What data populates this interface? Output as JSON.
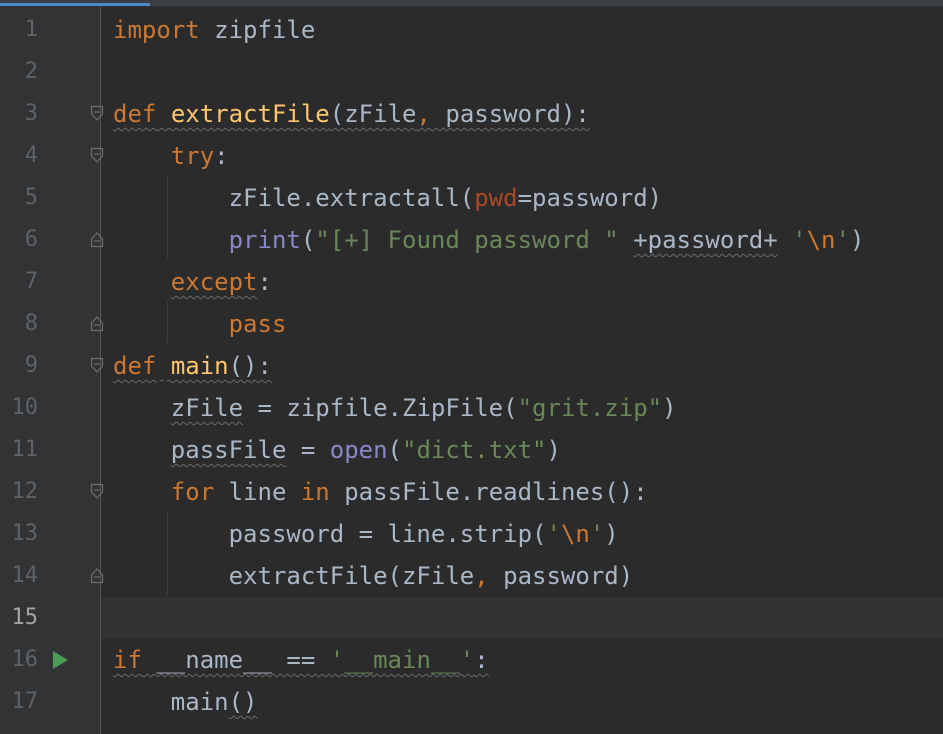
{
  "editor": {
    "current_line": 15,
    "lines": [
      {
        "num": "1",
        "tokens": [
          {
            "t": "import",
            "c": "kw"
          },
          {
            "t": " zipfile"
          }
        ]
      },
      {
        "num": "2",
        "tokens": []
      },
      {
        "num": "3",
        "tokens": [
          {
            "t": "def",
            "c": "kw",
            "w": true
          },
          {
            "t": " ",
            "w": true
          },
          {
            "t": "extractFile",
            "c": "fn",
            "w": true
          },
          {
            "t": "(zFile",
            "w": true
          },
          {
            "t": ",",
            "c": "kw",
            "w": true
          },
          {
            "t": " password):",
            "w": true
          }
        ]
      },
      {
        "num": "4",
        "tokens": [
          {
            "t": "    "
          },
          {
            "t": "try",
            "c": "kw"
          },
          {
            "t": ":"
          }
        ]
      },
      {
        "num": "5",
        "tokens": [
          {
            "t": "        zFile.extractall("
          },
          {
            "t": "pwd",
            "c": "param"
          },
          {
            "t": "=password)"
          }
        ]
      },
      {
        "num": "6",
        "tokens": [
          {
            "t": "        "
          },
          {
            "t": "print",
            "c": "bi"
          },
          {
            "t": "("
          },
          {
            "t": "\"[+] Found password \"",
            "c": "str"
          },
          {
            "t": " "
          },
          {
            "t": "+password+",
            "w": true
          },
          {
            "t": " "
          },
          {
            "t": "'",
            "c": "str"
          },
          {
            "t": "\\n",
            "c": "esc"
          },
          {
            "t": "'",
            "c": "str"
          },
          {
            "t": ")"
          }
        ]
      },
      {
        "num": "7",
        "tokens": [
          {
            "t": "    "
          },
          {
            "t": "except",
            "c": "kw",
            "w": true
          },
          {
            "t": ":"
          }
        ]
      },
      {
        "num": "8",
        "tokens": [
          {
            "t": "        "
          },
          {
            "t": "pass",
            "c": "kw"
          }
        ]
      },
      {
        "num": "9",
        "tokens": [
          {
            "t": "def",
            "c": "kw",
            "w": true
          },
          {
            "t": " ",
            "w": true
          },
          {
            "t": "main",
            "c": "fn",
            "w": true
          },
          {
            "t": "():",
            "w": true
          }
        ]
      },
      {
        "num": "10",
        "tokens": [
          {
            "t": "    "
          },
          {
            "t": "zFile",
            "w": true
          },
          {
            "t": " = zipfile.ZipFile("
          },
          {
            "t": "\"grit.zip\"",
            "c": "str"
          },
          {
            "t": ")"
          }
        ]
      },
      {
        "num": "11",
        "tokens": [
          {
            "t": "    "
          },
          {
            "t": "passFile",
            "w": true
          },
          {
            "t": " = "
          },
          {
            "t": "open",
            "c": "bi"
          },
          {
            "t": "("
          },
          {
            "t": "\"dict.txt\"",
            "c": "str"
          },
          {
            "t": ")"
          }
        ]
      },
      {
        "num": "12",
        "tokens": [
          {
            "t": "    "
          },
          {
            "t": "for",
            "c": "kw"
          },
          {
            "t": " line "
          },
          {
            "t": "in",
            "c": "kw"
          },
          {
            "t": " passFile.readlines():"
          }
        ]
      },
      {
        "num": "13",
        "tokens": [
          {
            "t": "        password = line.strip("
          },
          {
            "t": "'",
            "c": "str"
          },
          {
            "t": "\\n",
            "c": "esc"
          },
          {
            "t": "'",
            "c": "str"
          },
          {
            "t": ")"
          }
        ]
      },
      {
        "num": "14",
        "tokens": [
          {
            "t": "        extractFile(zFile"
          },
          {
            "t": ",",
            "c": "kw"
          },
          {
            "t": " password)"
          }
        ]
      },
      {
        "num": "15",
        "tokens": []
      },
      {
        "num": "16",
        "tokens": [
          {
            "t": "if",
            "c": "kw",
            "w": true
          },
          {
            "t": " __name__ == ",
            "w": true
          },
          {
            "t": "'__main__'",
            "c": "str",
            "w": true
          },
          {
            "t": ":",
            "w": true
          }
        ]
      },
      {
        "num": "17",
        "tokens": [
          {
            "t": "    main"
          },
          {
            "t": "()",
            "w": true
          }
        ]
      }
    ]
  },
  "gutter": {
    "fold_markers": [
      {
        "line": 3,
        "kind": "fold-open-icon"
      },
      {
        "line": 4,
        "kind": "fold-open-icon"
      },
      {
        "line": 6,
        "kind": "fold-end-icon"
      },
      {
        "line": 8,
        "kind": "fold-end-icon"
      },
      {
        "line": 9,
        "kind": "fold-open-icon"
      },
      {
        "line": 12,
        "kind": "fold-open-icon"
      },
      {
        "line": 14,
        "kind": "fold-end-icon"
      }
    ],
    "run_marker_line": 16,
    "run_icon": "run-icon"
  },
  "colors": {
    "background": "#2b2b2b",
    "gutter": "#313335",
    "keyword": "#cc7832",
    "function": "#ffc66d",
    "string": "#6a8759",
    "builtin": "#8888c6",
    "parameter": "#aa4926",
    "text": "#a9b7c6",
    "run_icon": "#499c54"
  }
}
